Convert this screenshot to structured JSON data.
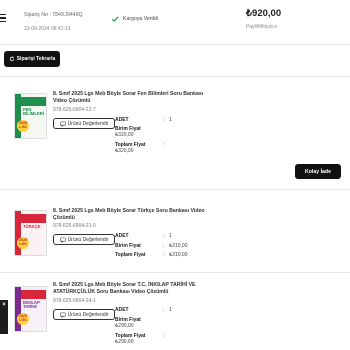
{
  "header": {
    "order_no": "Sipariş No : 784XJ9449Q",
    "order_date": "23-09-2024 08:42:13",
    "status": "Kargoya Verildi",
    "total": "₺920,00",
    "payment": "PayWithIyzico"
  },
  "actions": {
    "repeat_order": "Siparişi Tekrarla",
    "easy_return": "Kolay İade",
    "rate_product": "Ürünü Değerlendir"
  },
  "labels": {
    "quantity": "ADET",
    "unit_price": "Birim Fiyat",
    "total_price": "Toplam Fiyat",
    "colon": ":"
  },
  "products": [
    {
      "title": "8. Sınıf 2025 Lgs Meb Böyle Sorar Fen Bilimleri Soru Bankası Video Çözümlü",
      "code": "978-625-6904-22-7",
      "quantity": "1",
      "unit_price": "₺320,00",
      "total_price": "₺320,00",
      "cover_title": "FEN BİLİMLERİ",
      "cover_color": "#1f8f4e"
    },
    {
      "title": "8. Sınıf 2025 Lgs Meb Böyle Sorar Türkçe Soru Bankası Video Çözümlü",
      "code": "978-625-6904-21-0",
      "quantity": "1",
      "unit_price": "₺310,00",
      "total_price": "₺310,00",
      "cover_title": "TÜRKÇE",
      "cover_color": "#d8263a"
    },
    {
      "title": "8. Sınıf 2025 Lgs Meb Böyle Sorar T.C. İNKILAP TARİHİ VE ATATÜRKÇÜLÜK Soru Bankası Video Çözümlü",
      "code": "978-625-6904-24-1",
      "quantity": "1",
      "unit_price": "₺290,00",
      "total_price": "₺290,00",
      "cover_title": "İNKILAP TARİHİ",
      "cover_color": "#7c2a8f"
    }
  ],
  "cover_sticker": "2025 LGS",
  "side_tab_close": "×",
  "colors": {
    "accent": "#111111",
    "success": "#2aa84a"
  }
}
